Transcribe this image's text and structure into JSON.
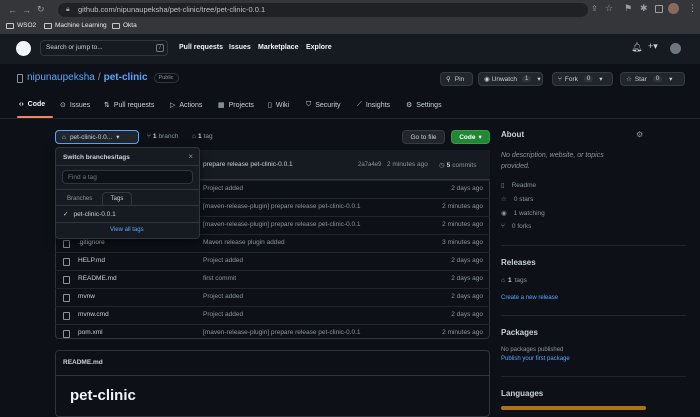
{
  "browser": {
    "url": "github.com/nipunaupeksha/pet-clinic/tree/pet-clinic-0.0.1",
    "bookmarks": [
      "WSO2",
      "Machine Learning",
      "Okta"
    ]
  },
  "header": {
    "search_placeholder": "Search or jump to...",
    "search_shortcut": "/",
    "nav": [
      "Pull requests",
      "Issues",
      "Marketplace",
      "Explore"
    ]
  },
  "repo": {
    "owner": "nipunaupeksha",
    "separator": "/",
    "name": "pet-clinic",
    "visibility": "Public",
    "pin_label": "Pin",
    "unwatch_label": "Unwatch",
    "unwatch_count": "1",
    "fork_label": "Fork",
    "fork_count": "0",
    "star_label": "Star",
    "star_count": "0"
  },
  "tabs": [
    "Code",
    "Issues",
    "Pull requests",
    "Actions",
    "Projects",
    "Wiki",
    "Security",
    "Insights",
    "Settings"
  ],
  "toolbar": {
    "branch_select": "pet-clinic-0.0...",
    "branch_count": "1",
    "branch_word": "branch",
    "tag_count": "1",
    "tag_word": "tag",
    "goto_file": "Go to file",
    "code_button": "Code"
  },
  "dropdown": {
    "title": "Switch branches/tags",
    "filter_placeholder": "Find a tag",
    "tabs": [
      "Branches",
      "Tags"
    ],
    "selected_item": "pet-clinic-0.0.1",
    "view_all": "View all tags"
  },
  "commit": {
    "message": "prepare release pet-clinic-0.0.1",
    "hash": "2a7a4e9",
    "time": "2 minutes ago",
    "commit_count": "5",
    "commit_word": "commits"
  },
  "files": [
    {
      "name": "",
      "message": "Project added",
      "date": "2 days ago"
    },
    {
      "name": "",
      "message": "[maven-release-plugin] prepare release pet-clinic-0.0.1",
      "date": "2 minutes ago"
    },
    {
      "name": "",
      "message": "[maven-release-plugin] prepare release pet-clinic-0.0.1",
      "date": "2 minutes ago"
    },
    {
      "name": ".gitignore",
      "message": "Maven release plugin added",
      "date": "3 minutes ago"
    },
    {
      "name": "HELP.md",
      "message": "Project added",
      "date": "2 days ago"
    },
    {
      "name": "README.md",
      "message": "first commit",
      "date": "2 days ago"
    },
    {
      "name": "mvnw",
      "message": "Project added",
      "date": "2 days ago"
    },
    {
      "name": "mvnw.cmd",
      "message": "Project added",
      "date": "2 days ago"
    },
    {
      "name": "pom.xml",
      "message": "[maven-release-plugin] prepare release pet-clinic-0.0.1",
      "date": "2 minutes ago"
    }
  ],
  "readme": {
    "filename": "README.md",
    "heading": "pet-clinic"
  },
  "about": {
    "title": "About",
    "description": "No description, website, or topics provided.",
    "readme": "Readme",
    "stars": "0 stars",
    "watching": "1 watching",
    "forks": "0 forks"
  },
  "releases": {
    "title": "Releases",
    "count": "1",
    "word": "tags",
    "create_link": "Create a new release"
  },
  "packages": {
    "title": "Packages",
    "none": "No packages published",
    "publish_link": "Publish your first package"
  },
  "languages": {
    "title": "Languages",
    "bar_color": "#b07219"
  },
  "colors": {
    "accent": "#58a6ff",
    "green": "#238636",
    "tab_underline": "#f78166"
  }
}
